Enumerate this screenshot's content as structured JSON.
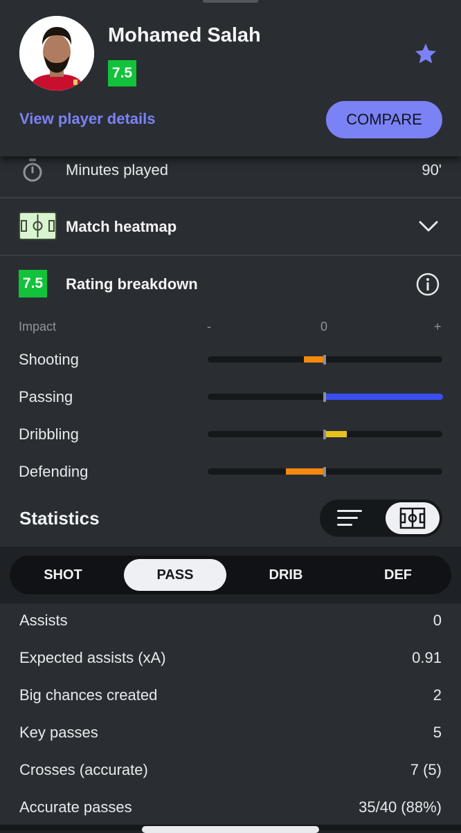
{
  "player": {
    "name": "Mohamed Salah",
    "rating": "7.5",
    "details_link": "View player details",
    "compare_label": "COMPARE"
  },
  "summary": {
    "minutes_label": "Minutes played",
    "minutes_value": "90'",
    "heatmap_label": "Match heatmap",
    "rating_label": "Rating breakdown",
    "rating_value": "7.5"
  },
  "impact": {
    "label": "Impact",
    "scale_minus": "-",
    "scale_zero": "0",
    "scale_plus": "+",
    "rows": [
      {
        "label": "Shooting",
        "value": -0.18,
        "color": "#f5890f"
      },
      {
        "label": "Passing",
        "value": 1.0,
        "color": "#3b4ff0"
      },
      {
        "label": "Dribbling",
        "value": 0.18,
        "color": "#e8c21c"
      },
      {
        "label": "Defending",
        "value": -0.33,
        "color": "#f5890f"
      }
    ]
  },
  "statistics": {
    "title": "Statistics",
    "tabs": [
      {
        "label": "SHOT",
        "active": false
      },
      {
        "label": "PASS",
        "active": true
      },
      {
        "label": "DRIB",
        "active": false
      },
      {
        "label": "DEF",
        "active": false
      }
    ],
    "rows": [
      {
        "label": "Assists",
        "value": "0"
      },
      {
        "label": "Expected assists (xA)",
        "value": "0.91"
      },
      {
        "label": "Big chances created",
        "value": "2"
      },
      {
        "label": "Key passes",
        "value": "5"
      },
      {
        "label": "Crosses (accurate)",
        "value": "7 (5)"
      },
      {
        "label": "Accurate passes",
        "value": "35/40 (88%)"
      }
    ]
  },
  "colors": {
    "accent": "#7b82f5",
    "rating_green": "#12c23a"
  }
}
